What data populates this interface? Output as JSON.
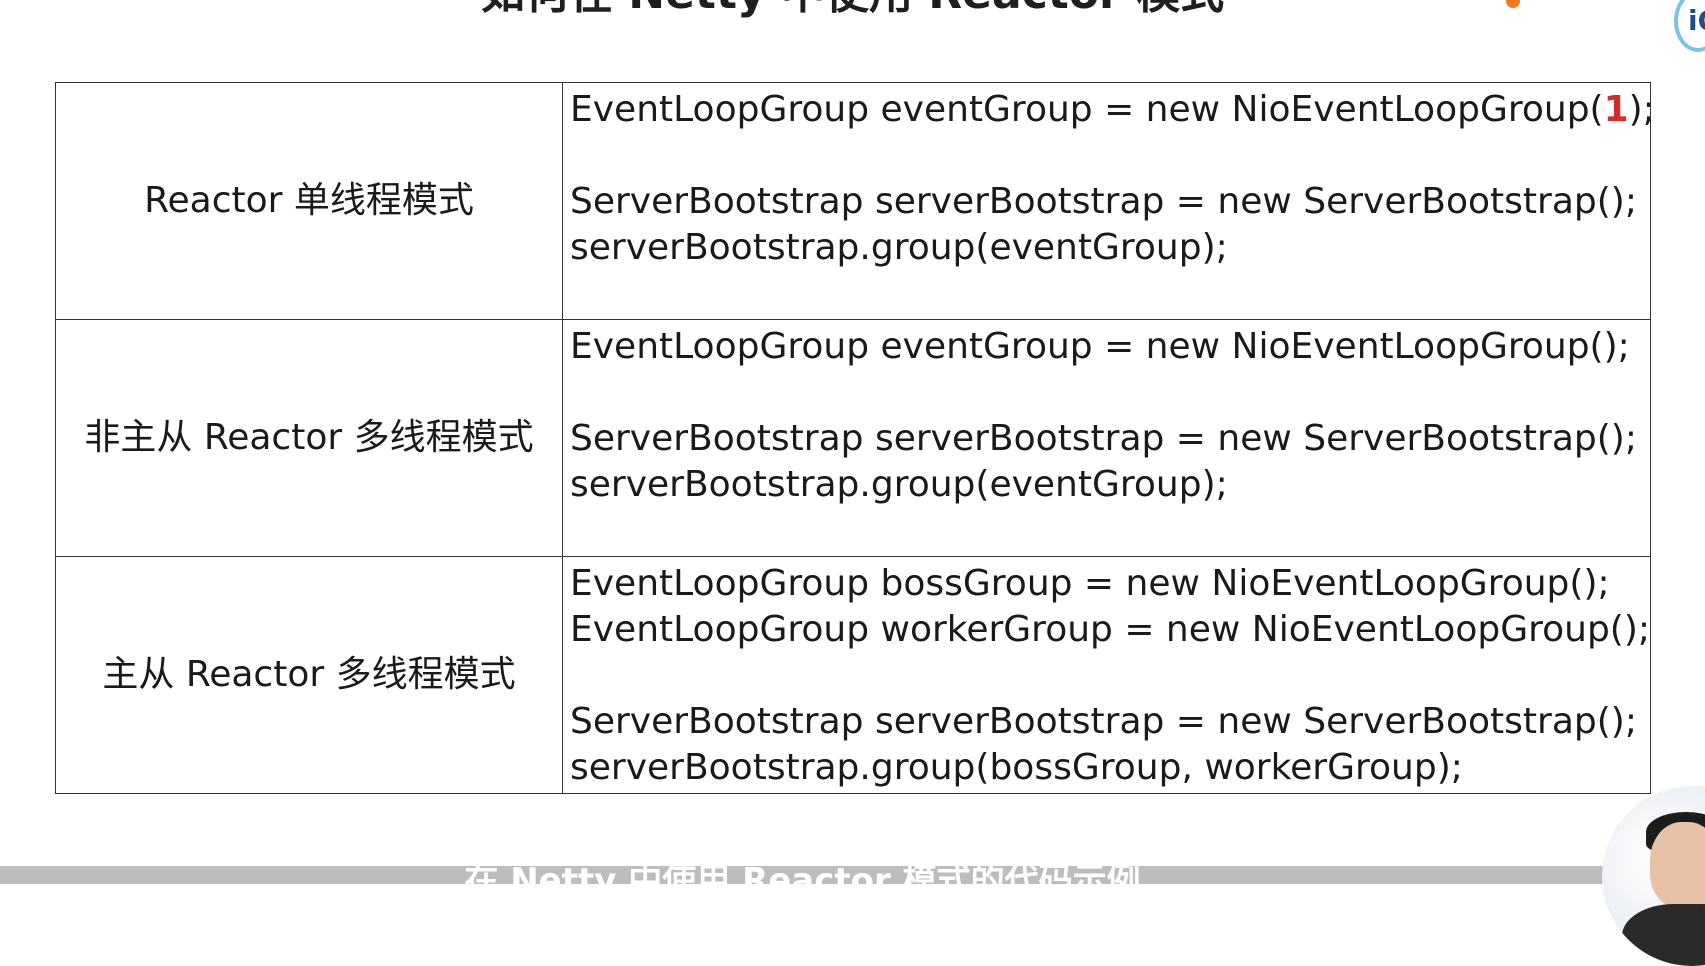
{
  "slide": {
    "title": "如何在 Netty 中使用 Reactor 模式",
    "subtitle": "在 Netty 中使用 Reactor 模式的代码示例"
  },
  "table": {
    "rows": [
      {
        "mode": "Reactor 单线程模式",
        "code": {
          "line1_before": "EventLoopGroup eventGroup = new NioEventLoopGroup(",
          "line1_highlight": "1",
          "line1_after": ");",
          "line2": "ServerBootstrap serverBootstrap = new ServerBootstrap();",
          "line3": "serverBootstrap.group(eventGroup);"
        }
      },
      {
        "mode": "非主从 Reactor 多线程模式",
        "code": {
          "line1": "EventLoopGroup eventGroup = new NioEventLoopGroup();",
          "line2": "ServerBootstrap serverBootstrap = new ServerBootstrap();",
          "line3": "serverBootstrap.group(eventGroup);"
        }
      },
      {
        "mode": "主从 Reactor 多线程模式",
        "code": {
          "line1": "EventLoopGroup bossGroup = new NioEventLoopGroup();",
          "line2": "EventLoopGroup workerGroup = new NioEventLoopGroup();",
          "line3": "ServerBootstrap serverBootstrap = new ServerBootstrap();",
          "line4": "serverBootstrap.group(bossGroup, workerGroup);"
        }
      }
    ]
  },
  "colors": {
    "highlight": "#d22b2b",
    "border": "#333333",
    "subtitle_bar": "#bdbdbd",
    "logo_ring": "#7dc3e6"
  },
  "icons": {
    "logo": "logo-icon",
    "presenter": "presenter-avatar"
  }
}
